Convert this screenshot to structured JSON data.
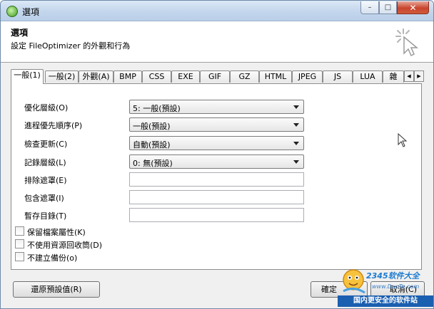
{
  "window": {
    "title": "選項",
    "controls": {
      "minimize": "–",
      "maximize": "□",
      "close": "✕"
    }
  },
  "header": {
    "title": "選項",
    "subtitle": "設定 FileOptimizer 的外觀和行為"
  },
  "tabs": [
    {
      "label": "一般(1)",
      "active": true
    },
    {
      "label": "一般(2)"
    },
    {
      "label": "外觀(A)"
    },
    {
      "label": "BMP"
    },
    {
      "label": "CSS"
    },
    {
      "label": "EXE"
    },
    {
      "label": "GIF"
    },
    {
      "label": "GZ"
    },
    {
      "label": "HTML"
    },
    {
      "label": "JPEG"
    },
    {
      "label": "JS"
    },
    {
      "label": "LUA"
    },
    {
      "label": "雜"
    }
  ],
  "form": {
    "optimization_level": {
      "label": "優化層級(O)",
      "value": "5: 一般(預設)"
    },
    "process_priority": {
      "label": "進程優先順序(P)",
      "value": "一般(預設)"
    },
    "check_updates": {
      "label": "檢查更新(C)",
      "value": "自動(預設)"
    },
    "log_level": {
      "label": "記錄層級(L)",
      "value": "0: 無(預設)"
    },
    "exclude_mask": {
      "label": "排除遮罩(E)",
      "value": ""
    },
    "include_mask": {
      "label": "包含遮罩(I)",
      "value": ""
    },
    "temp_dir": {
      "label": "暫存目錄(T)",
      "value": ""
    }
  },
  "checkboxes": [
    {
      "label": "保留檔案屬性(K)",
      "checked": false
    },
    {
      "label": "不使用資源回收筒(D)",
      "checked": false
    },
    {
      "label": "不建立備份(o)",
      "checked": false
    }
  ],
  "buttons": {
    "restore_defaults": "還原預設值(R)",
    "ok": "確定",
    "cancel": "取消(C)"
  },
  "watermark": {
    "brand": "2345软件大全",
    "url": "www.DuoTe.com",
    "slogan": "国内更安全的软件站"
  },
  "colors": {
    "titlebar": "#c3d6ec",
    "close_button": "#c8452e",
    "watermark_blue": "#1b5fb0"
  }
}
